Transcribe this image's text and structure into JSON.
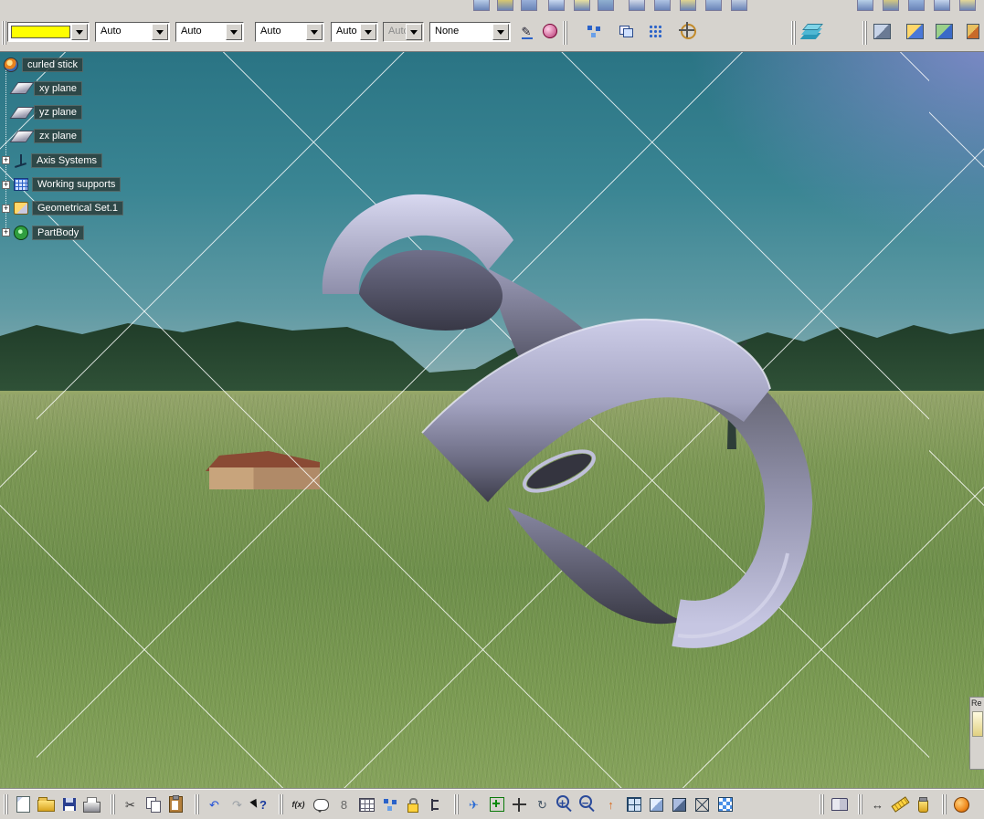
{
  "top_toolbar": {
    "swatch_color": "#ffff00",
    "combos": [
      {
        "name": "fill-color-combo",
        "type": "swatch",
        "value": ""
      },
      {
        "name": "line-weight-combo",
        "value": "Auto"
      },
      {
        "name": "line-type-combo",
        "value": "Auto"
      },
      {
        "name": "point-type-combo",
        "value": "Auto"
      },
      {
        "name": "symbol-combo",
        "value": "Auto"
      },
      {
        "name": "layer-combo",
        "value": "Auto",
        "disabled": true
      },
      {
        "name": "render-style-combo",
        "value": "None"
      }
    ],
    "paint_icons": [
      {
        "name": "painter-icon",
        "cls": "i-painter",
        "glyph": "✎"
      },
      {
        "name": "paint-wizard-icon",
        "cls": "i-wizard"
      }
    ],
    "mid_icons": [
      {
        "name": "specification-graph-icon",
        "cls": "i-links"
      },
      {
        "name": "window-layout-icon",
        "cls": "i-windows"
      },
      {
        "name": "dot-grid-icon",
        "cls": "i-dots"
      },
      {
        "name": "snap-target-icon",
        "cls": "i-target"
      }
    ],
    "layer_icons": [
      {
        "name": "layer-filter-icon",
        "cls": "i-layers"
      }
    ],
    "right_icons": [
      {
        "name": "blue-gray-tool-icon",
        "cls": "i-duo1"
      },
      {
        "name": "paint-tools-icon",
        "cls": "i-duo2"
      },
      {
        "name": "green-blue-tool-icon",
        "cls": "i-duo3"
      },
      {
        "name": "clipped-tool-icon",
        "cls": "i-duo4"
      }
    ]
  },
  "tree": {
    "items": [
      {
        "label": "curled stick",
        "icon": "part-icon",
        "level": 0,
        "expander": false
      },
      {
        "label": "xy plane",
        "icon": "plane-icon",
        "level": 1,
        "expander": false
      },
      {
        "label": "yz plane",
        "icon": "plane-icon",
        "level": 1,
        "expander": false
      },
      {
        "label": "zx plane",
        "icon": "plane-icon",
        "level": 1,
        "expander": false
      },
      {
        "label": "Axis Systems",
        "icon": "axis-icon",
        "level": 1,
        "expander": true
      },
      {
        "label": "Working supports",
        "icon": "support-grid-icon",
        "level": 1,
        "expander": true
      },
      {
        "label": "Geometrical Set.1",
        "icon": "geometrical-set-icon",
        "level": 1,
        "expander": true
      },
      {
        "label": "PartBody",
        "icon": "part-body-icon",
        "level": 1,
        "expander": true
      }
    ]
  },
  "viewport": {
    "scene": "grass field with tree line, farm house and windmill under a teal sky",
    "model": "curled lavender ribbon surface (curled stick)",
    "model_color": "#b9b9d6",
    "grid_color": "#ffffff",
    "sky_top": "#2a7484",
    "sky_purple": "#8a8fd0",
    "grass": "#7b9754"
  },
  "side_panel": {
    "title": "Re"
  },
  "bottom_toolbar": {
    "groups": [
      {
        "items": [
          {
            "name": "new-document-icon",
            "cls": "i-page"
          },
          {
            "name": "open-icon",
            "cls": "i-folder"
          },
          {
            "name": "save-icon",
            "cls": "i-floppy"
          },
          {
            "name": "print-icon",
            "cls": "i-print"
          }
        ]
      },
      {
        "items": [
          {
            "name": "cut-icon",
            "glyph": "✂",
            "color": "#333333"
          },
          {
            "name": "copy-icon",
            "cls": "i-copy"
          },
          {
            "name": "paste-icon",
            "cls": "i-paste"
          }
        ]
      },
      {
        "items": [
          {
            "name": "undo-icon",
            "glyph": "↶",
            "color": "#1f4fd8"
          },
          {
            "name": "redo-icon",
            "glyph": "↷",
            "color": "#9aa0a6"
          },
          {
            "name": "help-pointer-icon",
            "cls": "i-help",
            "glyph": "?"
          }
        ]
      },
      {
        "items": [
          {
            "name": "formula-icon",
            "glyph": "f(x)",
            "color": "#222222",
            "small": true
          },
          {
            "name": "comment-icon",
            "cls": "i-bubble"
          },
          {
            "name": "knowledge-icon",
            "glyph": "8",
            "color": "#666666"
          },
          {
            "name": "design-table-icon",
            "cls": "i-table"
          },
          {
            "name": "structure-links-icon",
            "cls": "i-links"
          },
          {
            "name": "lock-icon",
            "cls": "i-lock"
          },
          {
            "name": "constraints-icon",
            "cls": "i-brace"
          }
        ]
      },
      {
        "items": [
          {
            "name": "fly-mode-icon",
            "glyph": "✈",
            "color": "#2b6cd4"
          },
          {
            "name": "fit-all-icon",
            "cls": "i-fit"
          },
          {
            "name": "pan-icon",
            "cls": "i-pan"
          },
          {
            "name": "rotate-icon",
            "glyph": "↻",
            "color": "#445566"
          },
          {
            "name": "zoom-in-icon",
            "cls": "i-zoom",
            "glyph": "+"
          },
          {
            "name": "zoom-out-icon",
            "cls": "i-zoom",
            "glyph": "−"
          },
          {
            "name": "normal-view-icon",
            "glyph": "↑",
            "color": "#d86a1f"
          },
          {
            "name": "multi-view-icon",
            "cls": "i-quad"
          },
          {
            "name": "iso-view-icon",
            "cls": "i-cube"
          },
          {
            "name": "shaded-view-icon",
            "cls": "i-cube-shaded"
          },
          {
            "name": "wireframe-view-icon",
            "cls": "i-cube-wire"
          },
          {
            "name": "render-style-icon",
            "cls": "i-checker"
          }
        ]
      },
      {
        "items": [
          {
            "name": "catalog-icon",
            "cls": "i-book"
          }
        ]
      },
      {
        "items": [
          {
            "name": "measure-between-icon",
            "glyph": "↔",
            "color": "#333333"
          },
          {
            "name": "measure-item-icon",
            "cls": "i-ruler"
          },
          {
            "name": "inertia-icon",
            "cls": "i-jar"
          }
        ]
      },
      {
        "items": [
          {
            "name": "apply-material-icon",
            "cls": "i-material"
          }
        ]
      }
    ]
  }
}
